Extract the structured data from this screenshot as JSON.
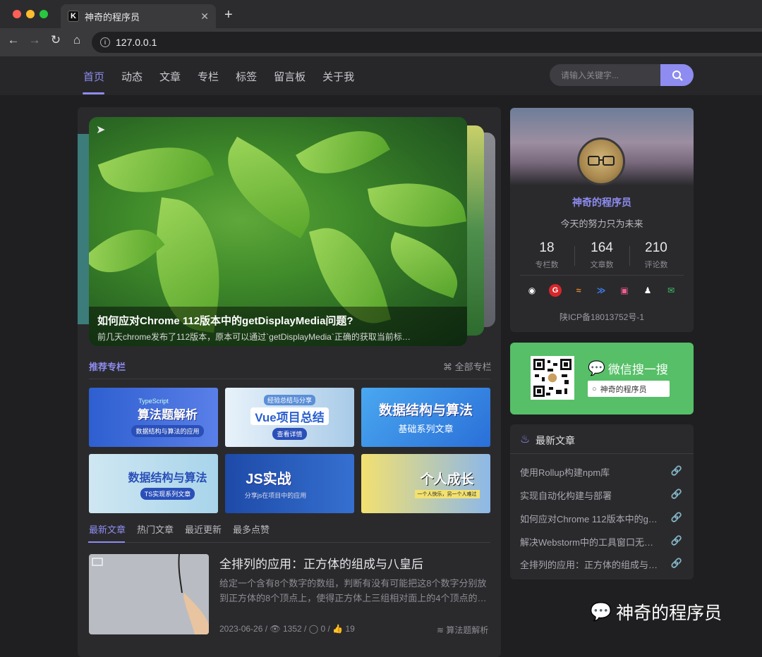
{
  "browser": {
    "tab_title": "神奇的程序员",
    "tab_favicon": "K",
    "url": "127.0.0.1"
  },
  "nav": {
    "items": [
      "首页",
      "动态",
      "文章",
      "专栏",
      "标签",
      "留言板",
      "关于我"
    ],
    "active_index": 0,
    "search_placeholder": "请输入关键字..."
  },
  "hero": {
    "title": "如何应对Chrome 112版本中的getDisplayMedia问题?",
    "desc": "前几天chrome发布了112版本，原本可以通过`getDisplayMedia`正确的获取当前标…"
  },
  "columns": {
    "title": "推荐专栏",
    "more": "全部专栏",
    "cards": [
      {
        "main": "算法题解析",
        "sub": "数据结构与算法的应用",
        "top": "TypeScript",
        "bg": "#3d63d8"
      },
      {
        "main": "Vue项目总结",
        "sub": "查看详情",
        "top": "经验总结与分享",
        "bg": "#a9cbe8"
      },
      {
        "main": "数据结构与算法",
        "sub": "基础系列文章",
        "top": "",
        "bg": "#3a8ee8"
      },
      {
        "main": "数据结构与算法",
        "sub": "TS实现系列文章",
        "top": "",
        "bg": "#bfe0ee"
      },
      {
        "main": "JS实战",
        "sub": "分享js在项目中的应用",
        "top": "",
        "bg": "#2f5fc0"
      },
      {
        "main": "个人成长",
        "sub": "一个人快乐，另一个人难过",
        "top": "",
        "bg": "#8db8e8"
      }
    ]
  },
  "post_tabs": [
    "最新文章",
    "热门文章",
    "最近更新",
    "最多点赞"
  ],
  "post": {
    "title": "全排列的应用：正方体的组成与八皇后",
    "excerpt": "给定一个含有8个数字的数组，判断有没有可能把这8个数字分别放到正方体的8个顶点上，使得正方体上三组相对面上的4个顶点的…",
    "date": "2023-06-26",
    "views": "1352",
    "comments": "0",
    "likes": "19",
    "category": "算法题解析"
  },
  "profile": {
    "name": "神奇的程序员",
    "motto": "今天的努力只为未来",
    "stats": [
      {
        "num": "18",
        "label": "专栏数"
      },
      {
        "num": "164",
        "label": "文章数"
      },
      {
        "num": "210",
        "label": "评论数"
      }
    ],
    "social_icons": [
      "github-icon",
      "gitee-icon",
      "rss-icon",
      "juejin-icon",
      "bilibili-icon",
      "qq-icon",
      "wechat-icon"
    ],
    "icp": "陕ICP备18013752号-1"
  },
  "wechat": {
    "title": "微信搜一搜",
    "search_text": "神奇的程序员"
  },
  "latest": {
    "title": "最新文章",
    "items": [
      "使用Rollup构建npm库",
      "实现自动化构建与部署",
      "如何应对Chrome 112版本中的g…",
      "解决Webstorm中的工具窗口无…",
      "全排列的应用：正方体的组成与…"
    ]
  },
  "watermark": "神奇的程序员",
  "colors": {
    "accent": "#8e8cf0",
    "wechat_green": "#56bf67"
  }
}
